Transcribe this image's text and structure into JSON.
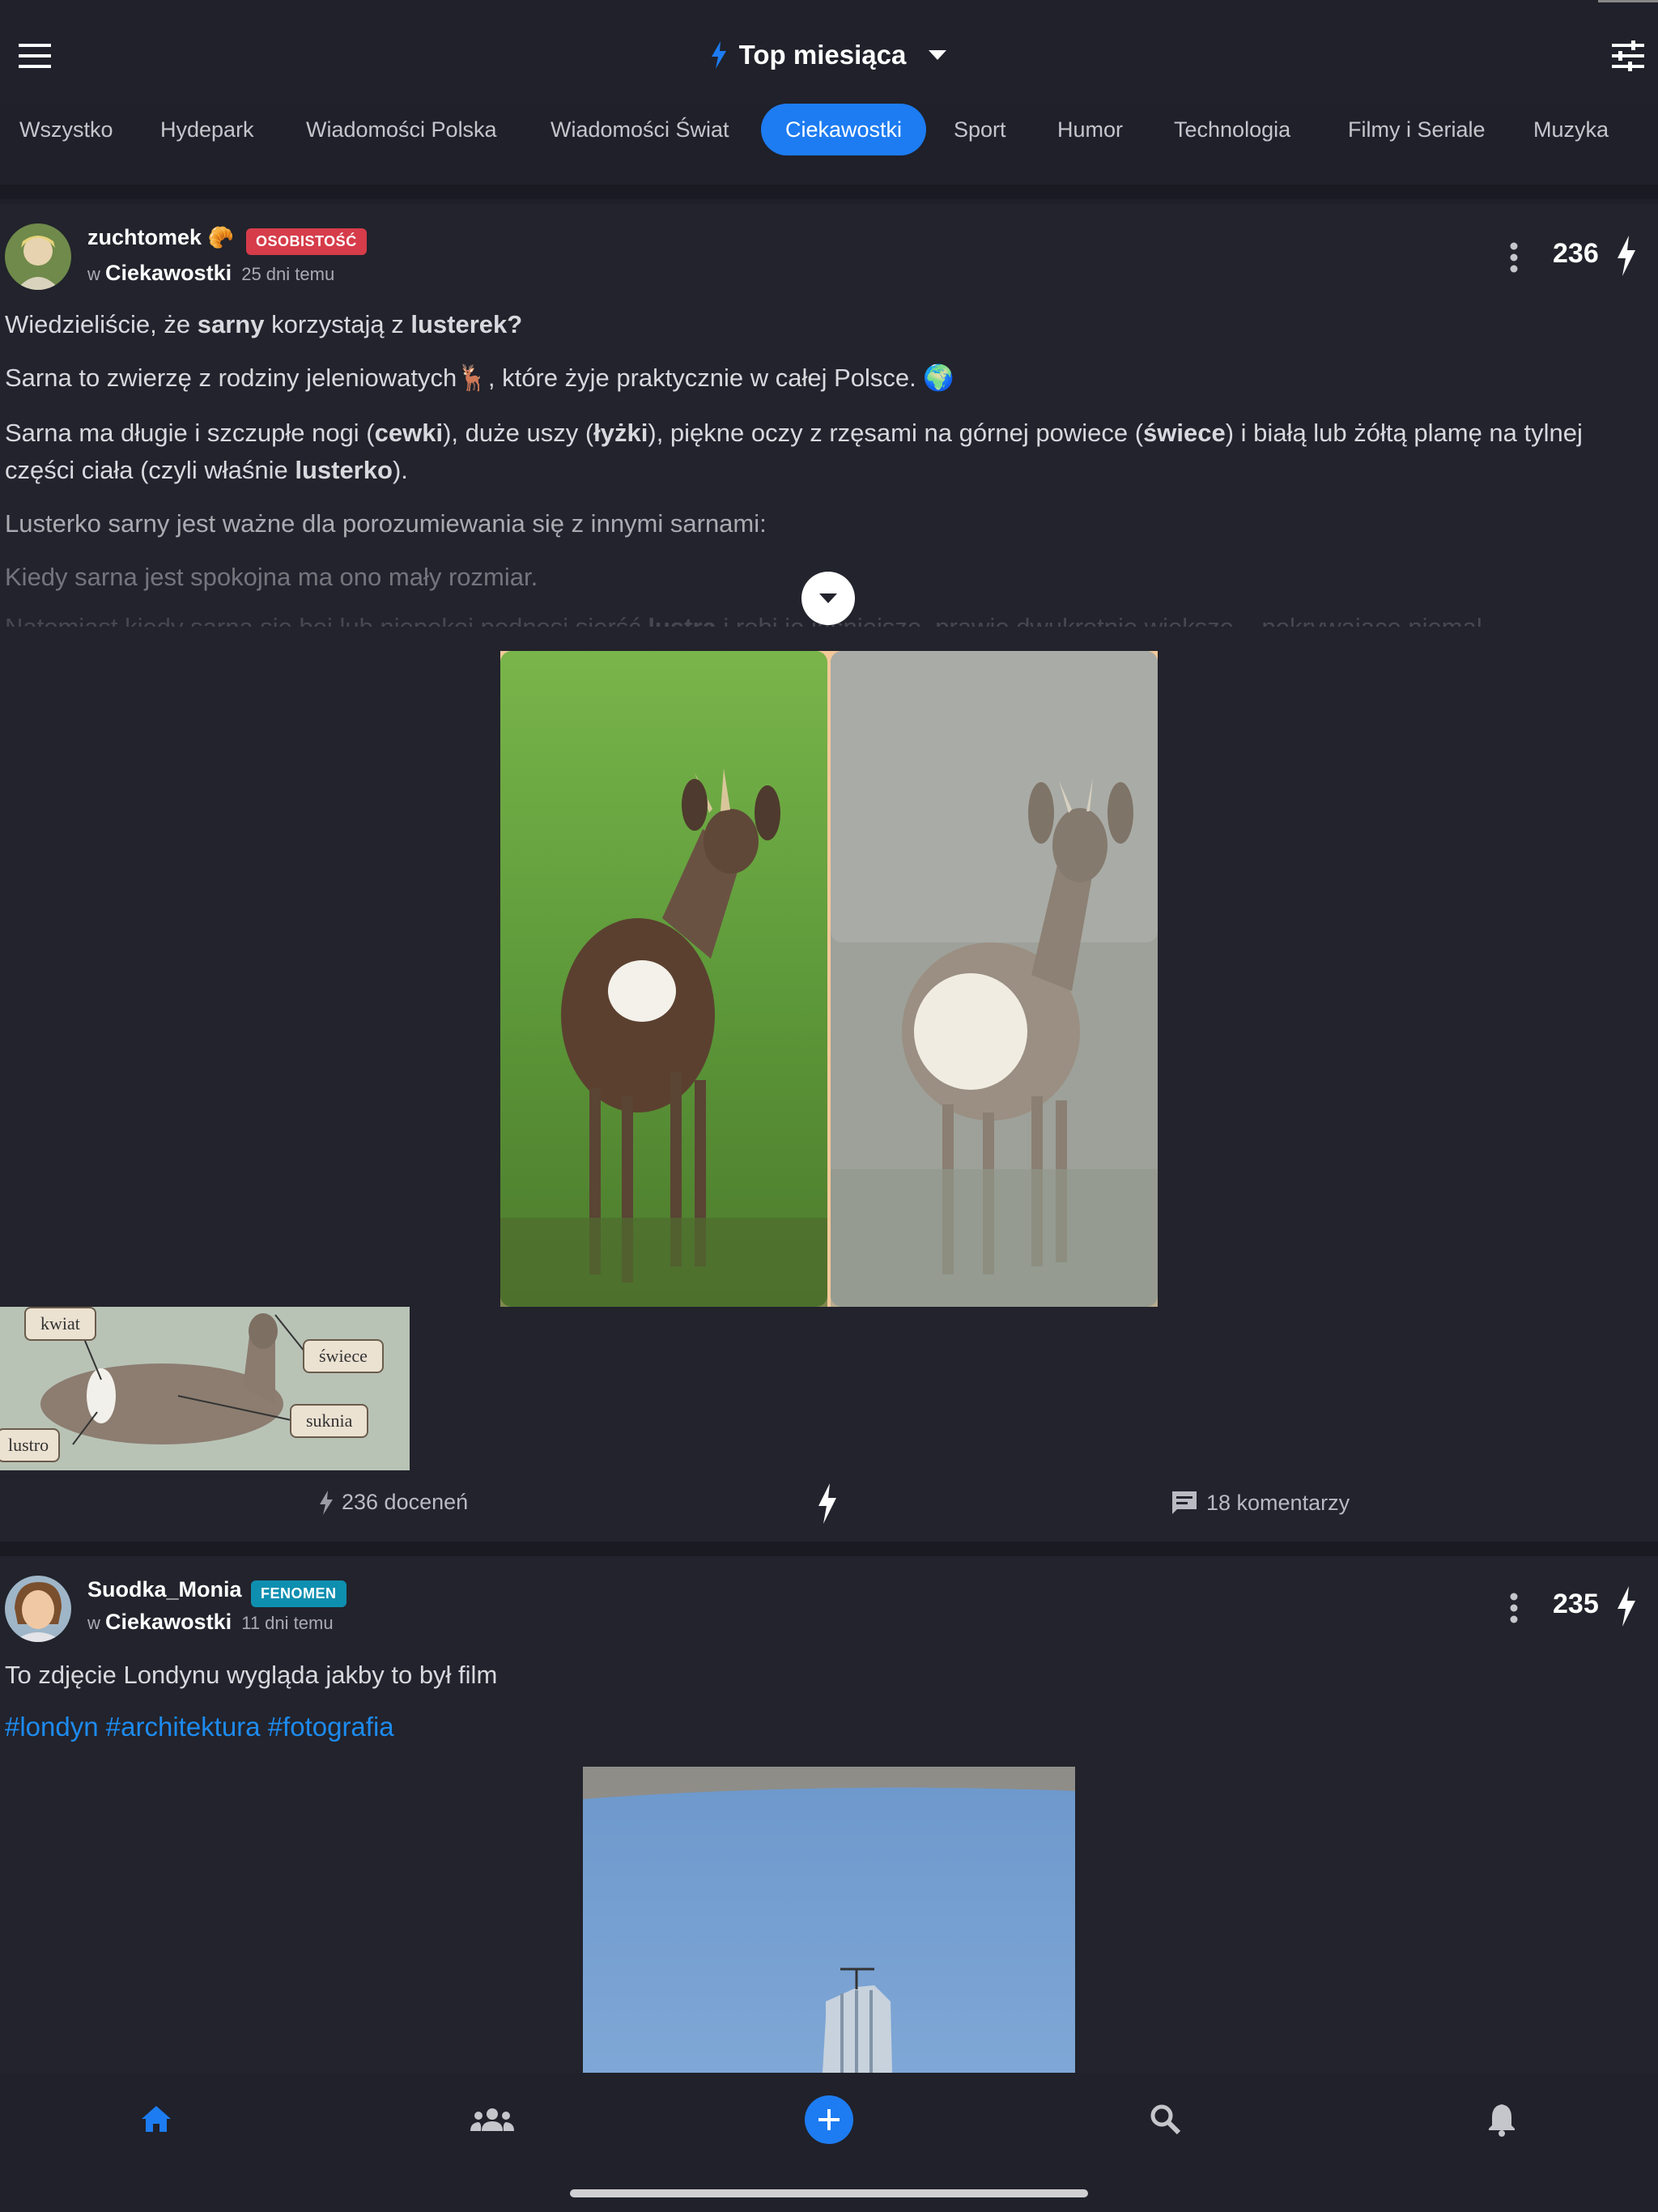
{
  "header": {
    "title": "Top miesiąca",
    "menu_icon": "hamburger-menu-icon",
    "filter_icon": "sliders-icon"
  },
  "tabs": [
    {
      "label": "Wszystko"
    },
    {
      "label": "Hydepark"
    },
    {
      "label": "Wiadomości Polska"
    },
    {
      "label": "Wiadomości Świat"
    },
    {
      "label": "Ciekawostki",
      "active": true
    },
    {
      "label": "Sport"
    },
    {
      "label": "Humor"
    },
    {
      "label": "Technologia"
    },
    {
      "label": "Filmy i Seriale"
    },
    {
      "label": "Muzyka"
    }
  ],
  "post1": {
    "username": "zuchtomek",
    "emoji": "🥐",
    "badge": "OSOBISTOŚĆ",
    "in_prefix": "w",
    "community": "Ciekawostki",
    "time": "25 dni temu",
    "score": "236",
    "lines": {
      "l1_a": "Wiedzieliście, że ",
      "l1_b": "sarny",
      "l1_c": " korzystają z ",
      "l1_d": "lusterek?",
      "l2": "Sarna to zwierzę z rodziny jeleniowatych🦌, które żyje praktycznie w całej Polsce. 🌍",
      "l3_a": "Sarna ma długie i szczupłe nogi (",
      "l3_b": "cewki",
      "l3_c": "), duże uszy (",
      "l3_d": "łyżki",
      "l3_e": "), piękne oczy z rzęsami na górnej powiece (",
      "l3_f": "świece",
      "l3_g": ") i białą lub żółtą plamę na tylnej części ciała (czyli właśnie ",
      "l3_h": "lusterko",
      "l3_i": ").",
      "l4": "Lusterko sarny jest ważne dla porozumiewania się z innymi sarnami:",
      "l5": "Kiedy sarna jest spokojna ma ono mały rozmiar.",
      "l6_a": "Natomiast kiedy sarna się boi lub niepokoi podnosi sierść ",
      "l6_b": "lustra",
      "l6_c": " i robi je jaśniejsze, prawie dwukrotnie większe – pokrywające niemal"
    },
    "diagram_labels": {
      "kwiat": "kwiat",
      "swiece": "świece",
      "suknia": "suknia",
      "lustro": "lustro"
    },
    "appreciations": "236 doceneń",
    "comments": "18 komentarzy"
  },
  "post2": {
    "username": "Suodka_Monia",
    "badge": "FENOMEN",
    "in_prefix": "w",
    "community": "Ciekawostki",
    "time": "11 dni temu",
    "score": "235",
    "text": "To zdjęcie Londynu wygląda jakby to był film",
    "tags": "#londyn #architektura #fotografia"
  },
  "nav": {
    "home": "home-icon",
    "groups": "people-icon",
    "add": "add-icon",
    "search": "search-icon",
    "notifications": "bell-icon"
  },
  "colors": {
    "accent": "#1d7cf2",
    "badge_osobistosc": "#d63c4a",
    "badge_fenomen": "#0f8fb0",
    "background": "#1f2029"
  }
}
